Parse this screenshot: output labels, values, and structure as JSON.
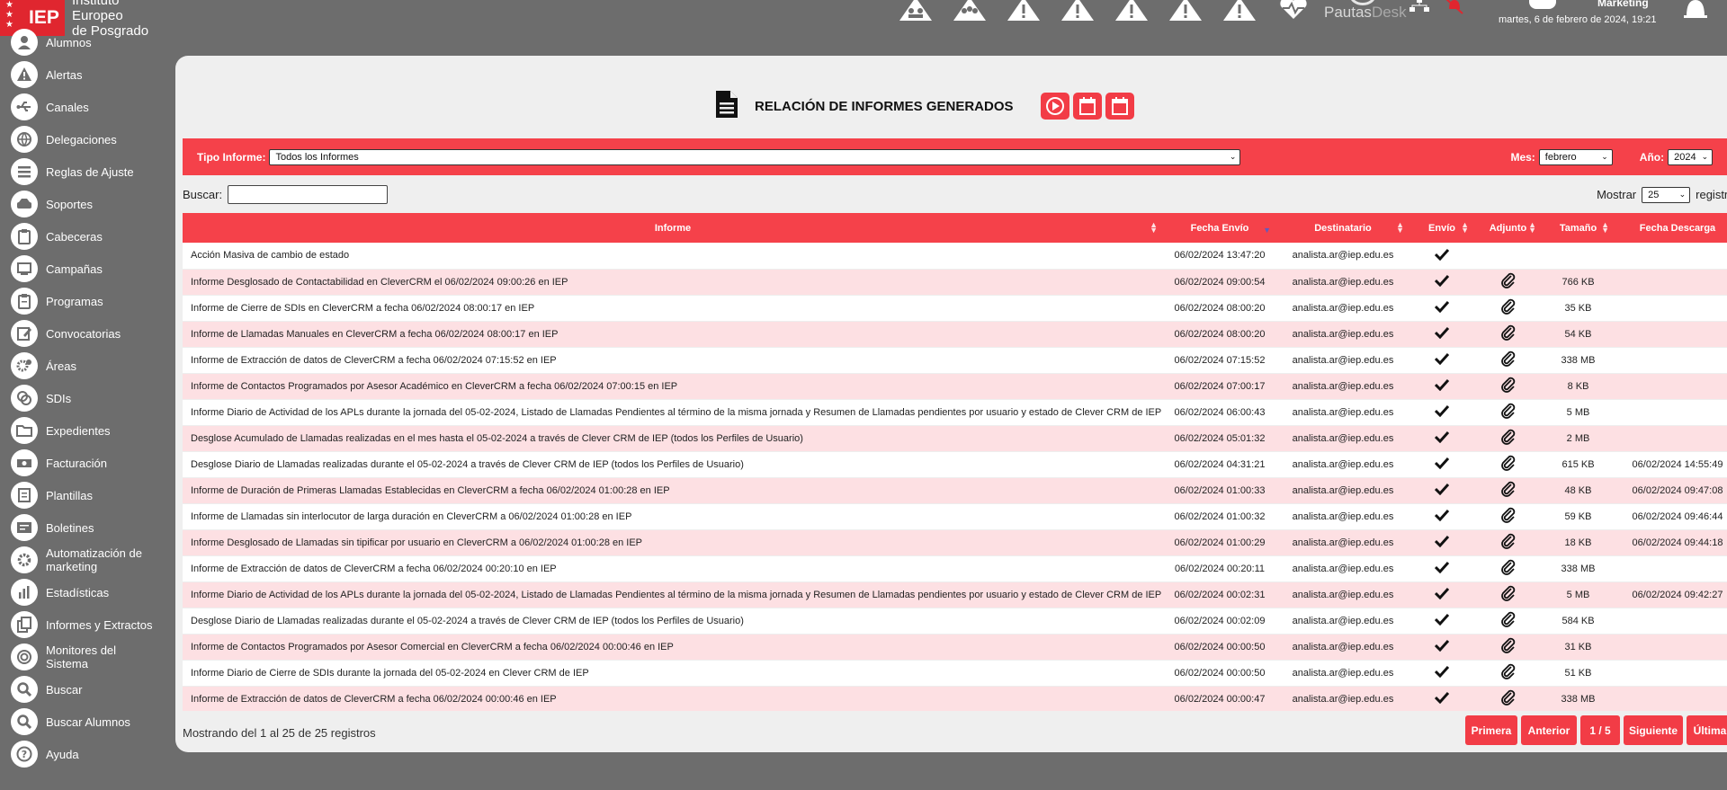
{
  "brand": {
    "logo_text": "IEP",
    "line1": "Instituto",
    "line2": "Europeo",
    "line3": "de Posgrado"
  },
  "header": {
    "pautas": "Pautas",
    "desk": "Desk",
    "user_role": "Marketing",
    "date": "martes, 6 de febrero de 2024, 19:21"
  },
  "sidebar": {
    "items": [
      {
        "label": "Alumnos"
      },
      {
        "label": "Alertas"
      },
      {
        "label": "Canales"
      },
      {
        "label": "Delegaciones"
      },
      {
        "label": "Reglas de Ajuste"
      },
      {
        "label": "Soportes"
      },
      {
        "label": "Cabeceras"
      },
      {
        "label": "Campañas"
      },
      {
        "label": "Programas"
      },
      {
        "label": "Convocatorias"
      },
      {
        "label": "Áreas"
      },
      {
        "label": "SDIs"
      },
      {
        "label": "Expedientes"
      },
      {
        "label": "Facturación"
      },
      {
        "label": "Plantillas"
      },
      {
        "label": "Boletines"
      },
      {
        "label": "Automatización de marketing"
      },
      {
        "label": "Estadísticas"
      },
      {
        "label": "Informes y Extractos"
      },
      {
        "label": "Monitores del Sistema"
      },
      {
        "label": "Buscar"
      },
      {
        "label": "Buscar Alumnos"
      },
      {
        "label": "Ayuda"
      }
    ]
  },
  "page": {
    "title": "RELACIÓN DE INFORMES GENERADOS"
  },
  "filters": {
    "tipo_label": "Tipo Informe:",
    "tipo_value": "Todos los Informes",
    "mes_label": "Mes:",
    "mes_value": "febrero",
    "anio_label": "Año:",
    "anio_value": "2024"
  },
  "search": {
    "label": "Buscar:",
    "value": "",
    "mostrar_label": "Mostrar",
    "mostrar_value": "25",
    "registros_label": "registros"
  },
  "table": {
    "headers": [
      "Informe",
      "Fecha Envío",
      "Destinatario",
      "Envío",
      "Adjunto",
      "Tamaño",
      "Fecha Descarga"
    ],
    "rows": [
      {
        "informe": "Acción Masiva de cambio de estado",
        "fecha": "06/02/2024 13:47:20",
        "dest": "analista.ar@iep.edu.es",
        "envio": true,
        "adjunto": false,
        "tam": "",
        "desc": ""
      },
      {
        "informe": "Informe Desglosado de Contactabilidad en CleverCRM el 06/02/2024 09:00:26 en IEP",
        "fecha": "06/02/2024 09:00:54",
        "dest": "analista.ar@iep.edu.es",
        "envio": true,
        "adjunto": true,
        "tam": "766 KB",
        "desc": ""
      },
      {
        "informe": "Informe de Cierre de SDIs en CleverCRM a fecha 06/02/2024 08:00:17 en IEP",
        "fecha": "06/02/2024 08:00:20",
        "dest": "analista.ar@iep.edu.es",
        "envio": true,
        "adjunto": true,
        "tam": "35 KB",
        "desc": ""
      },
      {
        "informe": "Informe de Llamadas Manuales en CleverCRM a fecha 06/02/2024 08:00:17 en IEP",
        "fecha": "06/02/2024 08:00:20",
        "dest": "analista.ar@iep.edu.es",
        "envio": true,
        "adjunto": true,
        "tam": "54 KB",
        "desc": ""
      },
      {
        "informe": "Informe de Extracción de datos de CleverCRM a fecha 06/02/2024 07:15:52 en IEP",
        "fecha": "06/02/2024 07:15:52",
        "dest": "analista.ar@iep.edu.es",
        "envio": true,
        "adjunto": true,
        "tam": "338 MB",
        "desc": ""
      },
      {
        "informe": "Informe de Contactos Programados por Asesor Académico en CleverCRM a fecha 06/02/2024 07:00:15 en IEP",
        "fecha": "06/02/2024 07:00:17",
        "dest": "analista.ar@iep.edu.es",
        "envio": true,
        "adjunto": true,
        "tam": "8 KB",
        "desc": ""
      },
      {
        "informe": "Informe Diario de Actividad de los APLs durante la jornada del 05-02-2024, Listado de Llamadas Pendientes al término de la misma jornada y Resumen de Llamadas pendientes por usuario y estado de Clever CRM de IEP",
        "fecha": "06/02/2024 06:00:43",
        "dest": "analista.ar@iep.edu.es",
        "envio": true,
        "adjunto": true,
        "tam": "5 MB",
        "desc": ""
      },
      {
        "informe": "Desglose Acumulado de Llamadas realizadas en el mes hasta el 05-02-2024 a través de Clever CRM de IEP (todos los Perfiles de Usuario)",
        "fecha": "06/02/2024 05:01:32",
        "dest": "analista.ar@iep.edu.es",
        "envio": true,
        "adjunto": true,
        "tam": "2 MB",
        "desc": ""
      },
      {
        "informe": "Desglose Diario de Llamadas realizadas durante el 05-02-2024 a través de Clever CRM de IEP (todos los Perfiles de Usuario)",
        "fecha": "06/02/2024 04:31:21",
        "dest": "analista.ar@iep.edu.es",
        "envio": true,
        "adjunto": true,
        "tam": "615 KB",
        "desc": "06/02/2024 14:55:49"
      },
      {
        "informe": "Informe de Duración de Primeras Llamadas Establecidas en CleverCRM a fecha 06/02/2024 01:00:28 en IEP",
        "fecha": "06/02/2024 01:00:33",
        "dest": "analista.ar@iep.edu.es",
        "envio": true,
        "adjunto": true,
        "tam": "48 KB",
        "desc": "06/02/2024 09:47:08"
      },
      {
        "informe": "Informe de Llamadas sin interlocutor de larga duración en CleverCRM a 06/02/2024 01:00:28 en IEP",
        "fecha": "06/02/2024 01:00:32",
        "dest": "analista.ar@iep.edu.es",
        "envio": true,
        "adjunto": true,
        "tam": "59 KB",
        "desc": "06/02/2024 09:46:44"
      },
      {
        "informe": "Informe Desglosado de Llamadas sin tipificar por usuario en CleverCRM a 06/02/2024 01:00:28 en IEP",
        "fecha": "06/02/2024 01:00:29",
        "dest": "analista.ar@iep.edu.es",
        "envio": true,
        "adjunto": true,
        "tam": "18 KB",
        "desc": "06/02/2024 09:44:18"
      },
      {
        "informe": "Informe de Extracción de datos de CleverCRM a fecha 06/02/2024 00:20:10 en IEP",
        "fecha": "06/02/2024 00:20:11",
        "dest": "analista.ar@iep.edu.es",
        "envio": true,
        "adjunto": true,
        "tam": "338 MB",
        "desc": ""
      },
      {
        "informe": "Informe Diario de Actividad de los APLs durante la jornada del 05-02-2024, Listado de Llamadas Pendientes al término de la misma jornada y Resumen de Llamadas pendientes por usuario y estado de Clever CRM de IEP",
        "fecha": "06/02/2024 00:02:31",
        "dest": "analista.ar@iep.edu.es",
        "envio": true,
        "adjunto": true,
        "tam": "5 MB",
        "desc": "06/02/2024 09:42:27"
      },
      {
        "informe": "Desglose Diario de Llamadas realizadas durante el 05-02-2024 a través de Clever CRM de IEP (todos los Perfiles de Usuario)",
        "fecha": "06/02/2024 00:02:09",
        "dest": "analista.ar@iep.edu.es",
        "envio": true,
        "adjunto": true,
        "tam": "584 KB",
        "desc": ""
      },
      {
        "informe": "Informe de Contactos Programados por Asesor Comercial en CleverCRM a fecha 06/02/2024 00:00:46 en IEP",
        "fecha": "06/02/2024 00:00:50",
        "dest": "analista.ar@iep.edu.es",
        "envio": true,
        "adjunto": true,
        "tam": "31 KB",
        "desc": ""
      },
      {
        "informe": "Informe Diario de Cierre de SDIs durante la jornada del 05-02-2024 en Clever CRM de IEP",
        "fecha": "06/02/2024 00:00:50",
        "dest": "analista.ar@iep.edu.es",
        "envio": true,
        "adjunto": true,
        "tam": "51 KB",
        "desc": ""
      },
      {
        "informe": "Informe de Extracción de datos de CleverCRM a fecha 06/02/2024 00:00:46 en IEP",
        "fecha": "06/02/2024 00:00:47",
        "dest": "analista.ar@iep.edu.es",
        "envio": true,
        "adjunto": true,
        "tam": "338 MB",
        "desc": ""
      }
    ]
  },
  "footer": {
    "info": "Mostrando del 1 al 25 de 25 registros",
    "pager": [
      "Primera",
      "Anterior",
      "1 / 5",
      "Siguiente",
      "Última"
    ]
  },
  "colors": {
    "accent": "#f5414a",
    "row_alt": "#fde0e3",
    "background": "#6d6d6d",
    "panel": "#efefef"
  }
}
